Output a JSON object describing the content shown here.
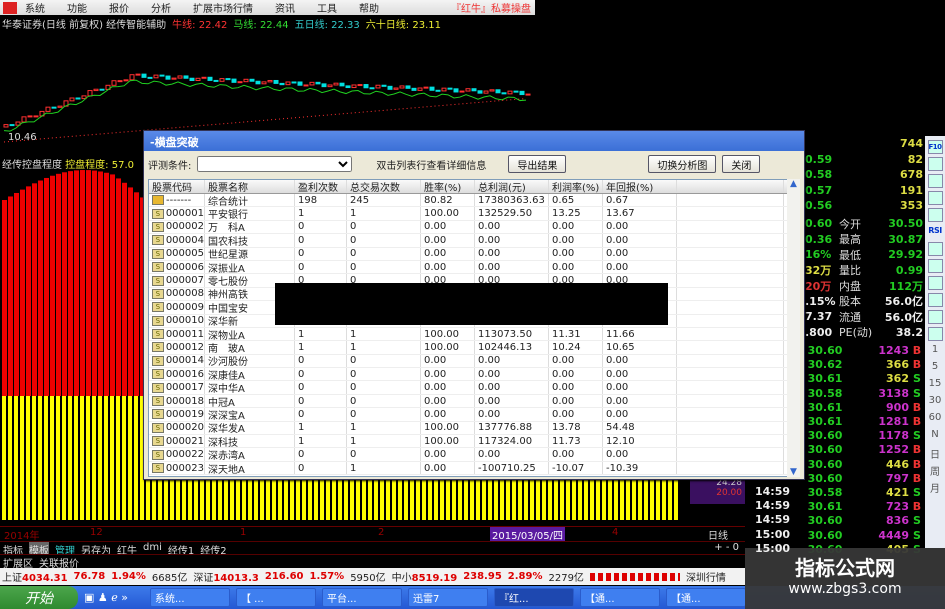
{
  "menu": {
    "items": [
      "系统",
      "功能",
      "报价",
      "分析",
      "扩展市场行情",
      "资讯",
      "工具",
      "帮助"
    ],
    "brand": "『红牛』私募操盘"
  },
  "chart_header": {
    "title": "华泰证券(日线 前复权) 经传智能辅助",
    "ma1_label": "牛线:",
    "ma1": "22.42",
    "ma2_label": "马线:",
    "ma2": "22.44",
    "ma3_label": "五日线:",
    "ma3": "22.33",
    "ma4_label": "六十日线:",
    "ma4": "23.11",
    "low_label": "10.46"
  },
  "indicator": {
    "name": "经传控盘程度",
    "label": "控盘程度:",
    "value": "57.0"
  },
  "date_axis": {
    "labels": [
      "2014年",
      "12",
      "1",
      "2",
      "3",
      "4"
    ],
    "cursor_date": "2015/03/05/四",
    "period": "日线",
    "zoom": "+ - 0",
    "ylabels": [
      "24.28",
      "20.00"
    ]
  },
  "tabs": [
    "指标",
    "模板",
    "管理",
    "另存为",
    "红牛",
    "dmi",
    "经传1",
    "经传2"
  ],
  "ext_tabs": [
    "扩展区",
    "关联报价"
  ],
  "status": {
    "sh_label": "上证",
    "sh": "4034.31",
    "sh_chg": "76.78",
    "sh_pct": "1.94%",
    "sh_amt": "6685亿",
    "sz_label": "深证",
    "sz": "14013.3",
    "sz_chg": "216.60",
    "sz_pct": "1.57%",
    "sz_amt": "5950亿",
    "zx_label": "中小",
    "zx": "8519.19",
    "zx_chg": "238.95",
    "zx_pct": "2.89%",
    "zx_amt": "2279亿",
    "right": "深圳行情"
  },
  "taskbar": {
    "start": "开始",
    "items": [
      "系统...",
      "【 ...",
      "平台...",
      "迅雷7",
      "『红...",
      "【通...",
      "【通..."
    ]
  },
  "dialog": {
    "title": "-横盘突破",
    "cond_label": "评测条件:",
    "hint": "双击列表行查看详细信息",
    "export": "导出结果",
    "switch": "切换分析图",
    "close": "关闭",
    "columns": [
      "股票代码",
      "股票名称",
      "盈利次数",
      "总交易次数",
      "胜率(%)",
      "总利润(元)",
      "利润率(%)",
      "年回报(%)"
    ],
    "rows": [
      [
        "-------",
        "综合统计",
        "198",
        "245",
        "80.82",
        "17380363.63",
        "0.65",
        "0.67"
      ],
      [
        "000001",
        "平安银行",
        "1",
        "1",
        "100.00",
        "132529.50",
        "13.25",
        "13.67"
      ],
      [
        "000002",
        "万　科A",
        "0",
        "0",
        "0.00",
        "0.00",
        "0.00",
        "0.00"
      ],
      [
        "000004",
        "国农科技",
        "0",
        "0",
        "0.00",
        "0.00",
        "0.00",
        "0.00"
      ],
      [
        "000005",
        "世纪星源",
        "0",
        "0",
        "0.00",
        "0.00",
        "0.00",
        "0.00"
      ],
      [
        "000006",
        "深振业A",
        "0",
        "0",
        "0.00",
        "0.00",
        "0.00",
        "0.00"
      ],
      [
        "000007",
        "零七股份",
        "0",
        "0",
        "0.00",
        "0.00",
        "0.00",
        "0.00"
      ],
      [
        "000008",
        "神州高铁",
        "",
        "",
        "",
        "",
        "",
        ""
      ],
      [
        "000009",
        "中国宝安",
        "",
        "",
        "",
        "",
        "",
        ""
      ],
      [
        "000010",
        "深华新",
        "",
        "",
        "",
        "",
        "",
        "6"
      ],
      [
        "000011",
        "深物业A",
        "1",
        "1",
        "100.00",
        "113073.50",
        "11.31",
        "11.66"
      ],
      [
        "000012",
        "南　玻A",
        "1",
        "1",
        "100.00",
        "102446.13",
        "10.24",
        "10.65"
      ],
      [
        "000014",
        "沙河股份",
        "0",
        "0",
        "0.00",
        "0.00",
        "0.00",
        "0.00"
      ],
      [
        "000016",
        "深康佳A",
        "0",
        "0",
        "0.00",
        "0.00",
        "0.00",
        "0.00"
      ],
      [
        "000017",
        "深中华A",
        "0",
        "0",
        "0.00",
        "0.00",
        "0.00",
        "0.00"
      ],
      [
        "000018",
        "中冠A",
        "0",
        "0",
        "0.00",
        "0.00",
        "0.00",
        "0.00"
      ],
      [
        "000019",
        "深深宝A",
        "0",
        "0",
        "0.00",
        "0.00",
        "0.00",
        "0.00"
      ],
      [
        "000020",
        "深华发A",
        "1",
        "1",
        "100.00",
        "137776.88",
        "13.78",
        "54.48"
      ],
      [
        "000021",
        "深科技",
        "1",
        "1",
        "100.00",
        "117324.00",
        "11.73",
        "12.10"
      ],
      [
        "000022",
        "深赤湾A",
        "0",
        "0",
        "0.00",
        "0.00",
        "0.00",
        "0.00"
      ],
      [
        "000023",
        "深天地A",
        "0",
        "1",
        "0.00",
        "-100710.25",
        "-10.07",
        "-10.39"
      ]
    ]
  },
  "quote_panel": {
    "top": [
      [
        "",
        "744"
      ],
      [
        "0.59",
        "82"
      ],
      [
        "0.58",
        "678"
      ],
      [
        "0.57",
        "191"
      ],
      [
        "0.56",
        "353"
      ]
    ],
    "stats": [
      [
        "0.60",
        "今开",
        "30.50"
      ],
      [
        "0.36",
        "最高",
        "30.87"
      ],
      [
        "16%",
        "最低",
        "29.92"
      ],
      [
        "32万",
        "量比",
        "0.99"
      ],
      [
        "20万",
        "内盘",
        "112万"
      ],
      [
        ".15%",
        "股本",
        "56.0亿"
      ],
      [
        "7.37",
        "流通",
        "56.0亿"
      ],
      [
        ".800",
        "PE(动)",
        "38.2"
      ]
    ],
    "ticks": [
      [
        "",
        "30.60",
        "1243",
        "B"
      ],
      [
        "",
        "30.62",
        "366",
        "B"
      ],
      [
        "",
        "30.61",
        "362",
        "S"
      ],
      [
        "",
        "30.58",
        "3138",
        "S"
      ],
      [
        "",
        "30.61",
        "900",
        "B"
      ],
      [
        "",
        "30.61",
        "1281",
        "B"
      ],
      [
        "",
        "30.60",
        "1178",
        "S"
      ],
      [
        "",
        "30.60",
        "1252",
        "B"
      ],
      [
        "",
        "30.60",
        "446",
        "B"
      ],
      [
        "",
        "30.60",
        "797",
        "B"
      ],
      [
        "14:59",
        "30.58",
        "421",
        "S"
      ],
      [
        "14:59",
        "30.61",
        "723",
        "B"
      ],
      [
        "14:59",
        "30.60",
        "836",
        "S"
      ],
      [
        "15:00",
        "30.60",
        "4449",
        "S"
      ],
      [
        "15:00",
        "30.60",
        "405",
        "S"
      ]
    ]
  },
  "side_toolbar": {
    "icons": [
      "F10",
      "Fn",
      "chart",
      "search",
      "ma",
      "RSI",
      "$",
      "move",
      "dot",
      "pen",
      "FS",
      "img"
    ],
    "periods": [
      "1",
      "5",
      "15",
      "30",
      "60",
      "N",
      "日",
      "周",
      "月"
    ]
  },
  "watermark": {
    "name": "指标公式网",
    "url": "www.zbgs3.com"
  },
  "colors": {
    "up": "#ff3030",
    "down": "#00e0e0",
    "ma_green": "#20d020",
    "yellow": "#ffff00",
    "purple": "#d040d0"
  }
}
